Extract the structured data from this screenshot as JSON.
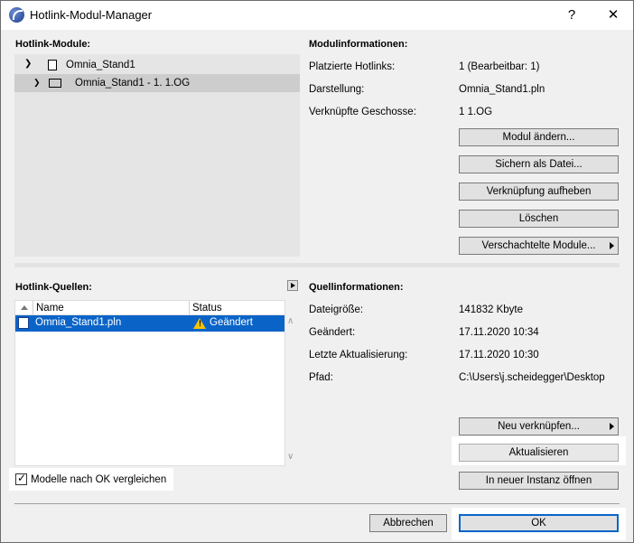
{
  "window": {
    "title": "Hotlink-Modul-Manager",
    "help_label": "?",
    "close_label": "✕"
  },
  "modules": {
    "label": "Hotlink-Module:",
    "tree": [
      {
        "name": "Omnia_Stand1",
        "expanded": true,
        "icon": "module-icon"
      },
      {
        "name": "Omnia_Stand1 - 1. 1.OG",
        "expanded": false,
        "icon": "linked-module-icon"
      }
    ]
  },
  "module_info": {
    "label": "Modulinformationen:",
    "rows": [
      {
        "key": "Platzierte Hotlinks:",
        "value": "1 (Bearbeitbar: 1)"
      },
      {
        "key": "Darstellung:",
        "value": "Omnia_Stand1.pln"
      },
      {
        "key": "Verknüpfte Geschosse:",
        "value": "1 1.OG"
      }
    ],
    "buttons": {
      "change": "Modul ändern...",
      "save_as": "Sichern als Datei...",
      "unlink": "Verknüpfung aufheben",
      "delete": "Löschen",
      "nested": "Verschachtelte Module..."
    }
  },
  "sources": {
    "label": "Hotlink-Quellen:",
    "columns": [
      "Name",
      "Status"
    ],
    "rows": [
      {
        "name": "Omnia_Stand1.pln",
        "status": "Geändert",
        "status_icon": "warning-icon"
      }
    ]
  },
  "source_info": {
    "label": "Quellinformationen:",
    "rows": [
      {
        "key": "Dateigröße:",
        "value": "141832 Kbyte"
      },
      {
        "key": "Geändert:",
        "value": "17.11.2020 10:34"
      },
      {
        "key": "Letzte Aktualisierung:",
        "value": "17.11.2020 10:30"
      },
      {
        "key": "Pfad:",
        "value": "C:\\Users\\j.scheidegger\\Desktop"
      }
    ],
    "buttons": {
      "relink": "Neu verknüpfen...",
      "update": "Aktualisieren",
      "open_new": "In neuer Instanz öffnen"
    }
  },
  "compare": {
    "label": "Modelle nach OK vergleichen",
    "checked": true
  },
  "footer": {
    "cancel": "Abbrechen",
    "ok": "OK"
  }
}
